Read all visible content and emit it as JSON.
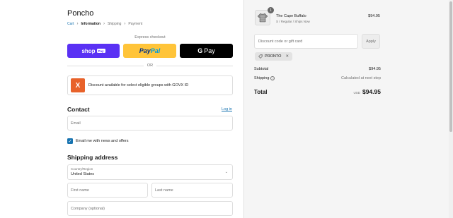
{
  "store": {
    "name": "Poncho"
  },
  "breadcrumb": {
    "cart": "Cart",
    "information": "Information",
    "shipping": "Shipping",
    "payment": "Payment"
  },
  "express": {
    "label": "Express checkout",
    "shop_pay": {
      "text": "shop",
      "badge": "Pay"
    },
    "paypal": {
      "part1": "Pay",
      "part2": "Pal"
    },
    "gpay": {
      "g": "G",
      "text": "Pay"
    }
  },
  "or_text": "OR",
  "govx": {
    "logo_letter": "X",
    "text": "Discount available for select eligible groups with GOVX ID"
  },
  "contact": {
    "title": "Contact",
    "login_link": "Log in",
    "email_placeholder": "Email",
    "newsletter_label": "Email me with news and offers",
    "newsletter_checked": true
  },
  "shipping": {
    "title": "Shipping address",
    "country_label": "Country/Region",
    "country_value": "United States",
    "first_name_placeholder": "First name",
    "last_name_placeholder": "Last name",
    "company_placeholder": "Company (optional)"
  },
  "cart": {
    "items": [
      {
        "name": "The Cape Buffalo",
        "variant": "S / Regular / Ships Now",
        "price": "$94.95",
        "quantity": "1",
        "icon": "shirt-icon"
      }
    ]
  },
  "discount": {
    "placeholder": "Discount code or gift card",
    "apply_label": "Apply",
    "applied_code": "PRONTO"
  },
  "summary": {
    "subtotal_label": "Subtotal",
    "subtotal_value": "$94.95",
    "shipping_label": "Shipping",
    "shipping_value": "Calculated at next step",
    "total_label": "Total",
    "total_currency": "USD",
    "total_value": "$94.95"
  },
  "colors": {
    "shop_pay": "#5a31f4",
    "paypal": "#ffc439",
    "gpay": "#000000",
    "link": "#1773b0",
    "govx": "#e8622a",
    "sidebar_bg": "#f5f5f5"
  }
}
